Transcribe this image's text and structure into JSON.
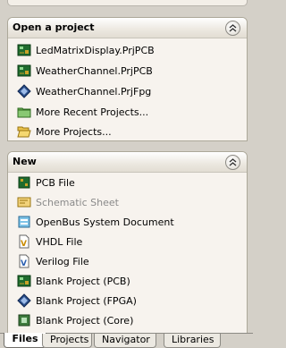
{
  "open_project": {
    "title": "Open a project",
    "items": [
      {
        "label": "LedMatrixDisplay.PrjPCB",
        "icon": "pcb-project-icon",
        "disabled": false
      },
      {
        "label": "WeatherChannel.PrjPCB",
        "icon": "pcb-project-icon",
        "disabled": false
      },
      {
        "label": "WeatherChannel.PrjFpg",
        "icon": "fpga-project-icon",
        "disabled": false
      },
      {
        "label": "More Recent Projects...",
        "icon": "green-folder-icon",
        "disabled": false
      },
      {
        "label": "More Projects...",
        "icon": "open-folder-icon",
        "disabled": false
      }
    ]
  },
  "new": {
    "title": "New",
    "items": [
      {
        "label": "PCB File",
        "icon": "pcb-file-icon",
        "disabled": false
      },
      {
        "label": "Schematic Sheet",
        "icon": "schematic-sheet-icon",
        "disabled": true
      },
      {
        "label": "OpenBus System Document",
        "icon": "openbus-document-icon",
        "disabled": false
      },
      {
        "label": "VHDL File",
        "icon": "vhdl-file-icon",
        "disabled": false
      },
      {
        "label": "Verilog File",
        "icon": "verilog-file-icon",
        "disabled": false
      },
      {
        "label": "Blank Project (PCB)",
        "icon": "pcb-project-icon",
        "disabled": false
      },
      {
        "label": "Blank Project (FPGA)",
        "icon": "fpga-project-icon",
        "disabled": false
      },
      {
        "label": "Blank Project (Core)",
        "icon": "core-project-icon",
        "disabled": false
      }
    ]
  },
  "tabs": [
    {
      "label": "Files",
      "active": true
    },
    {
      "label": "Projects",
      "active": false
    },
    {
      "label": "Navigator",
      "active": false
    },
    {
      "label": "Libraries",
      "active": false
    }
  ]
}
